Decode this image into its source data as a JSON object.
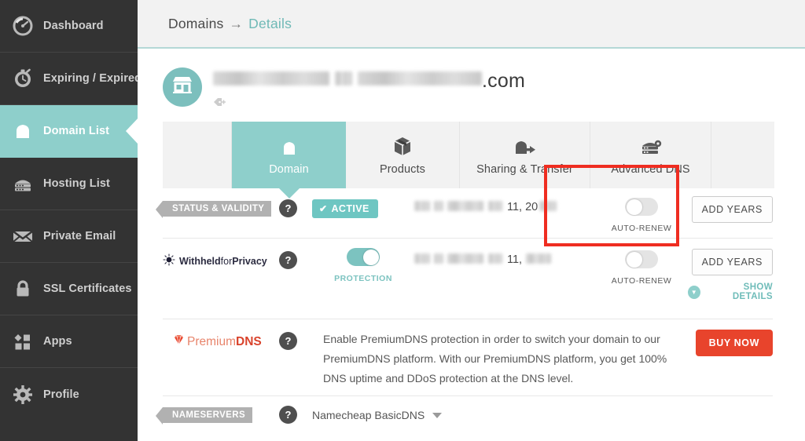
{
  "sidebar": {
    "items": [
      {
        "label": "Dashboard",
        "icon": "gauge-icon",
        "active": false
      },
      {
        "label": "Expiring / Expired",
        "icon": "clock-icon",
        "active": false
      },
      {
        "label": "Domain List",
        "icon": "house-icon",
        "active": true
      },
      {
        "label": "Hosting List",
        "icon": "server-icon",
        "active": false
      },
      {
        "label": "Private Email",
        "icon": "envelope-icon",
        "active": false
      },
      {
        "label": "SSL Certificates",
        "icon": "lock-icon",
        "active": false
      },
      {
        "label": "Apps",
        "icon": "apps-icon",
        "active": false
      },
      {
        "label": "Profile",
        "icon": "gear-icon",
        "active": false
      }
    ]
  },
  "breadcrumb": {
    "root": "Domains",
    "separator": "→",
    "current": "Details"
  },
  "domain": {
    "redacted_name": "",
    "tld": ".com"
  },
  "tabs": [
    {
      "label": "Domain",
      "icon": "house-icon",
      "active": true,
      "highlighted": false
    },
    {
      "label": "Products",
      "icon": "box-icon",
      "active": false,
      "highlighted": false
    },
    {
      "label": "Sharing & Transfer",
      "icon": "house-arrow-icon",
      "active": false,
      "highlighted": false
    },
    {
      "label": "Advanced DNS",
      "icon": "dns-server-icon",
      "active": false,
      "highlighted": true
    }
  ],
  "rows": {
    "status": {
      "label": "STATUS & VALIDITY",
      "help": "?",
      "badge": "ACTIVE",
      "badge_check": "✔",
      "date_prefix_redacted": "",
      "date_tail": "11, 20",
      "autorenew_caption": "AUTO-RENEW",
      "autorenew_on": false,
      "button": "ADD YEARS"
    },
    "privacy": {
      "logo_bold1": "Withheld",
      "logo_light": "for",
      "logo_bold2": "Privacy",
      "help": "?",
      "protection_caption": "PROTECTION",
      "protection_on": true,
      "date_prefix_redacted": "",
      "date_tail": "11,",
      "autorenew_caption": "AUTO-RENEW",
      "autorenew_on": false,
      "button": "ADD YEARS",
      "show_details": "SHOW DETAILS"
    },
    "premiumdns": {
      "logo_light": "Premium",
      "logo_bold": "DNS",
      "help": "?",
      "description": "Enable PremiumDNS protection in order to switch your domain to our PremiumDNS platform. With our PremiumDNS platform, you get 100% DNS uptime and DDoS protection at the DNS level.",
      "button": "BUY NOW"
    },
    "nameservers": {
      "label": "NAMESERVERS",
      "help": "?",
      "selected": "Namecheap BasicDNS"
    }
  },
  "colors": {
    "teal": "#8ecfcb",
    "teal_dark": "#6fb9b6",
    "sidebar_bg": "#333333",
    "red_highlight": "#ef2d21",
    "buy_red": "#e8442c",
    "pill_grey": "#b1b1b1"
  }
}
